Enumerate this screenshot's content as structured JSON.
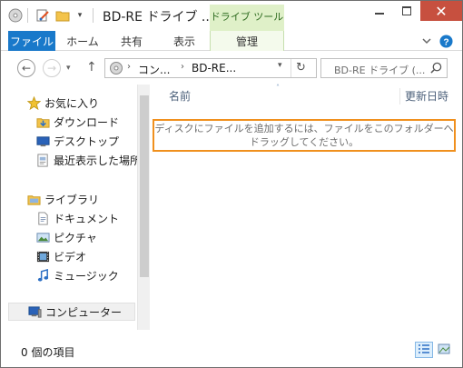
{
  "window": {
    "title": "BD-RE ドライブ ...",
    "context_tab_group": "ドライブ ツール",
    "close_glyph": "✕"
  },
  "ribbon": {
    "tabs": [
      "ファイル",
      "ホーム",
      "共有",
      "表示",
      "管理"
    ]
  },
  "address": {
    "crumbs": [
      "コン...",
      "BD-RE..."
    ],
    "search_placeholder": "BD-RE ドライブ (..."
  },
  "nav": {
    "favorites": {
      "label": "お気に入り",
      "items": [
        "ダウンロード",
        "デスクトップ",
        "最近表示した場所"
      ]
    },
    "libraries": {
      "label": "ライブラリ",
      "items": [
        "ドキュメント",
        "ピクチャ",
        "ビデオ",
        "ミュージック"
      ]
    },
    "computer": "コンピューター"
  },
  "content": {
    "columns": [
      "名前",
      "更新日時"
    ],
    "empty_message": "ディスクにファイルを追加するには、ファイルをこのフォルダーへドラッグしてください。"
  },
  "status": {
    "item_count": "0 個の項目"
  },
  "colors": {
    "file_tab": "#1979ca",
    "context_tab": "#dff0c8",
    "close_button": "#c7503f",
    "highlight_border": "#f0901e"
  }
}
